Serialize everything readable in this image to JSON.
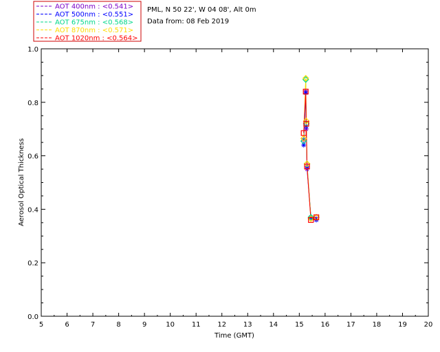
{
  "legend": {
    "entries": [
      {
        "label": "AOT  400nm : <0.541>",
        "color": "#7a00c8"
      },
      {
        "label": "AOT  500nm : <0.551>",
        "color": "#0000ff"
      },
      {
        "label": "AOT  675nm : <0.568>",
        "color": "#00d88a"
      },
      {
        "label": "AOT  870nm : <0.571>",
        "color": "#ffdc00"
      },
      {
        "label": "AOT 1020nm : <0.564>",
        "color": "#ff0000"
      }
    ]
  },
  "info": {
    "site": "PML, N 50 22', W 04 08', Alt 0m",
    "date": "Data from: 08 Feb 2019"
  },
  "chart_data": {
    "type": "line",
    "xlabel": "Time (GMT)",
    "ylabel": "Aerosol Optical Thickness",
    "xlim": [
      5,
      20
    ],
    "ylim": [
      0.0,
      1.0
    ],
    "xticks": [
      "5",
      "6",
      "7",
      "8",
      "9",
      "10",
      "11",
      "12",
      "13",
      "14",
      "15",
      "16",
      "17",
      "18",
      "19",
      "20"
    ],
    "yticks": [
      "0.0",
      "0.2",
      "0.4",
      "0.6",
      "0.8",
      "1.0"
    ],
    "grid": false,
    "legend_position": "top-left, outside plot",
    "series": [
      {
        "name": "AOT  400nm : <0.541>",
        "color": "#7a00c8",
        "marker": "star",
        "x": [
          15.17,
          15.25,
          15.27,
          15.3,
          15.45,
          15.66
        ],
        "y": [
          0.66,
          0.84,
          0.7,
          0.55,
          0.37,
          0.365
        ]
      },
      {
        "name": "AOT  500nm : <0.551>",
        "color": "#0000ff",
        "marker": "star",
        "x": [
          15.17,
          15.25,
          15.27,
          15.3,
          15.45,
          15.66
        ],
        "y": [
          0.64,
          0.835,
          0.71,
          0.56,
          0.37,
          0.36
        ]
      },
      {
        "name": "AOT  675nm : <0.568>",
        "color": "#00d88a",
        "marker": "diamond",
        "x": [
          15.17,
          15.25,
          15.27,
          15.3,
          15.45,
          15.66
        ],
        "y": [
          0.655,
          0.885,
          0.72,
          0.57,
          0.37,
          0.37
        ]
      },
      {
        "name": "AOT  870nm : <0.571>",
        "color": "#ffdc00",
        "marker": "diamond",
        "x": [
          15.17,
          15.25,
          15.27,
          15.3,
          15.45,
          15.66
        ],
        "y": [
          0.665,
          0.89,
          0.73,
          0.57,
          0.365,
          0.37
        ]
      },
      {
        "name": "AOT 1020nm : <0.564>",
        "color": "#ff0000",
        "marker": "square",
        "x": [
          15.17,
          15.25,
          15.27,
          15.3,
          15.45,
          15.66
        ],
        "y": [
          0.685,
          0.84,
          0.72,
          0.56,
          0.36,
          0.37
        ]
      }
    ]
  }
}
